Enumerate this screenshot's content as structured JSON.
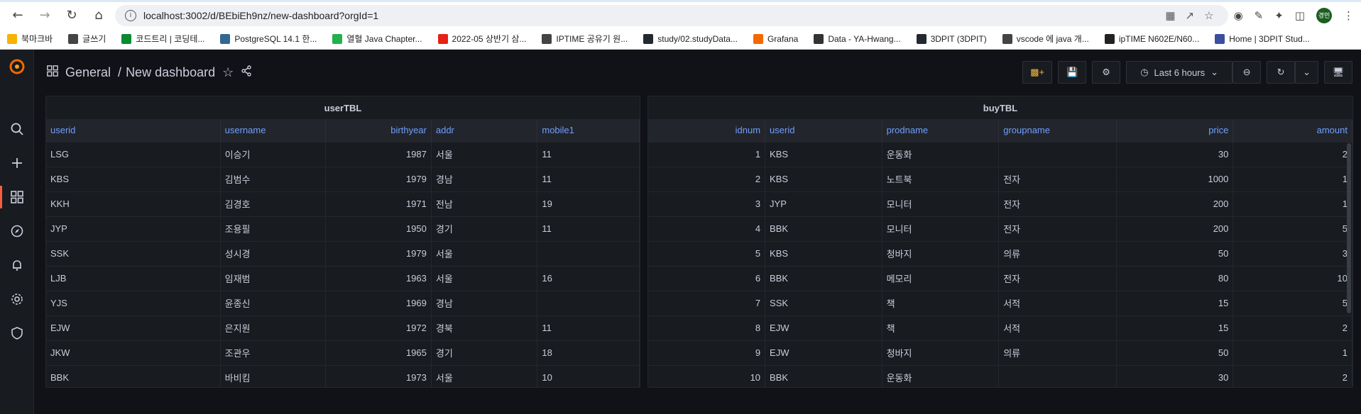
{
  "browser": {
    "url": "localhost:3002/d/BEbiEh9nz/new-dashboard?orgId=1",
    "profile_label": "경민"
  },
  "bookmarks": [
    {
      "label": "북마크바",
      "color": "#f5b400"
    },
    {
      "label": "글쓰기",
      "color": "#444444"
    },
    {
      "label": "코드트리 | 코딩테...",
      "color": "#0b8a2f"
    },
    {
      "label": "PostgreSQL 14.1 한...",
      "color": "#336791"
    },
    {
      "label": "열혈 Java Chapter...",
      "color": "#22b14c"
    },
    {
      "label": "2022-05 상반기 삼...",
      "color": "#e62117"
    },
    {
      "label": "IPTIME 공유기 원...",
      "color": "#444444"
    },
    {
      "label": "study/02.studyData...",
      "color": "#24292f"
    },
    {
      "label": "Grafana",
      "color": "#f46800"
    },
    {
      "label": "Data - YA-Hwang...",
      "color": "#333333"
    },
    {
      "label": "3DPIT (3DPIT)",
      "color": "#24292f"
    },
    {
      "label": "vscode 에 java 개...",
      "color": "#444444"
    },
    {
      "label": "ipTIME N602E/N60...",
      "color": "#222222"
    },
    {
      "label": "Home | 3DPIT Stud...",
      "color": "#3b4fa0"
    }
  ],
  "header": {
    "section": "General",
    "separator": "/",
    "title": "New dashboard",
    "time_range": "Last 6 hours"
  },
  "user_table": {
    "title": "userTBL",
    "columns": [
      "userid",
      "username",
      "birthyear",
      "addr",
      "mobile1"
    ],
    "rows": [
      [
        "LSG",
        "이승기",
        "1987",
        "서울",
        "11"
      ],
      [
        "KBS",
        "김범수",
        "1979",
        "경남",
        "11"
      ],
      [
        "KKH",
        "김경호",
        "1971",
        "전남",
        "19"
      ],
      [
        "JYP",
        "조용필",
        "1950",
        "경기",
        "11"
      ],
      [
        "SSK",
        "성시경",
        "1979",
        "서울",
        ""
      ],
      [
        "LJB",
        "임재범",
        "1963",
        "서울",
        "16"
      ],
      [
        "YJS",
        "윤종신",
        "1969",
        "경남",
        ""
      ],
      [
        "EJW",
        "은지원",
        "1972",
        "경북",
        "11"
      ],
      [
        "JKW",
        "조관우",
        "1965",
        "경기",
        "18"
      ],
      [
        "BBK",
        "바비킴",
        "1973",
        "서울",
        "10"
      ]
    ]
  },
  "buy_table": {
    "title": "buyTBL",
    "columns": [
      "idnum",
      "userid",
      "prodname",
      "groupname",
      "price",
      "amount"
    ],
    "rows": [
      [
        "1",
        "KBS",
        "운동화",
        "",
        "30",
        "2"
      ],
      [
        "2",
        "KBS",
        "노트북",
        "전자",
        "1000",
        "1"
      ],
      [
        "3",
        "JYP",
        "모니터",
        "전자",
        "200",
        "1"
      ],
      [
        "4",
        "BBK",
        "모니터",
        "전자",
        "200",
        "5"
      ],
      [
        "5",
        "KBS",
        "청바지",
        "의류",
        "50",
        "3"
      ],
      [
        "6",
        "BBK",
        "메모리",
        "전자",
        "80",
        "10"
      ],
      [
        "7",
        "SSK",
        "책",
        "서적",
        "15",
        "5"
      ],
      [
        "8",
        "EJW",
        "책",
        "서적",
        "15",
        "2"
      ],
      [
        "9",
        "EJW",
        "청바지",
        "의류",
        "50",
        "1"
      ],
      [
        "10",
        "BBK",
        "운동화",
        "",
        "30",
        "2"
      ]
    ]
  }
}
